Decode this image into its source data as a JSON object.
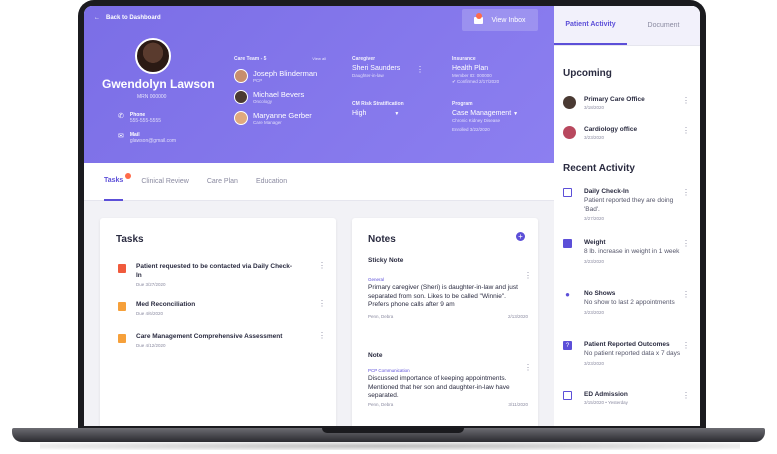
{
  "header": {
    "back_label": "Back to Dashboard",
    "inbox_label": "View Inbox",
    "patient": {
      "name": "Gwendolyn Lawson",
      "mrn": "MRN 000000",
      "phone_label": "Phone",
      "phone_value": "555-555-5555",
      "mail_label": "Mail",
      "mail_value": "glawson@gmail.com"
    },
    "care_team": {
      "title": "Care Team - 5",
      "view_all": "View all",
      "members": [
        {
          "name": "Joseph Blinderman",
          "role": "PCP"
        },
        {
          "name": "Michael Bevers",
          "role": "Oncology"
        },
        {
          "name": "Maryanne Gerber",
          "role": "Care Manager"
        }
      ]
    },
    "caregiver": {
      "label": "Caregiver",
      "name": "Sheri Saunders",
      "relation": "Daughter-in-law"
    },
    "risk": {
      "label": "CM Risk Stratification",
      "value": "High"
    },
    "insurance": {
      "label": "Insurance",
      "plan": "Health Plan",
      "member_id": "Member ID: 000000",
      "confirmed": "Confirmed 2/17/2020"
    },
    "program": {
      "label": "Program",
      "value": "Case Management",
      "detail": "Chronic Kidney Disease",
      "enrolled": "Enrolled 3/22/2020"
    }
  },
  "tabs": [
    {
      "label": "Tasks"
    },
    {
      "label": "Clinical Review"
    },
    {
      "label": "Care Plan"
    },
    {
      "label": "Education"
    }
  ],
  "tasks": {
    "title": "Tasks",
    "items": [
      {
        "title": "Patient requested to be contacted via Daily Check-In",
        "due": "Due 3/27/2020",
        "color": "#f05a3c"
      },
      {
        "title": "Med Reconciliation",
        "due": "Due 4/6/2020",
        "color": "#f6a03a"
      },
      {
        "title": "Care Management Comprehensive Assessment",
        "due": "Due 4/12/2020",
        "color": "#f6a03a"
      }
    ]
  },
  "notes": {
    "title": "Notes",
    "sticky_header": "Sticky Note",
    "sticky": {
      "category": "General",
      "body": "Primary caregiver (Sheri) is daughter-in-law and just separated from son. Likes to be called \"Winnie\". Prefers phone calls after 9 am",
      "author": "Penn, Debra",
      "date": "2/13/2020"
    },
    "note_header": "Note",
    "note": {
      "category": "PCP Communication",
      "body": "Discussed importance of keeping appointments. Mentioned that her son and daughter-in-law have separated.",
      "author": "Penn, Debra",
      "date": "3/11/2020"
    }
  },
  "panel": {
    "tabs": [
      "Patient Activity",
      "Document"
    ],
    "upcoming_title": "Upcoming",
    "upcoming": [
      {
        "title": "Primary Care Office",
        "date": "3/18/2020"
      },
      {
        "title": "Cardiology office",
        "date": "3/23/2020"
      }
    ],
    "recent_title": "Recent Activity",
    "recent": [
      {
        "title": "Daily Check-In",
        "desc": "Patient reported they are doing 'Bad'.",
        "date": "3/27/2020"
      },
      {
        "title": "Weight",
        "desc": "8 lb. increase in weight in 1 week",
        "date": "3/23/2020"
      },
      {
        "title": "No Shows",
        "desc": "No show to last 2 appointments",
        "date": "3/23/2020"
      },
      {
        "title": "Patient Reported Outcomes",
        "desc": "No patient reported data x 7 days",
        "date": "3/23/2020"
      },
      {
        "title": "ED Admission",
        "desc": "",
        "date": "3/15/2020 • Yesterday"
      }
    ]
  },
  "colors": {
    "primary": "#7b6ee6",
    "accent": "#5c4fd8",
    "alert": "#ff6b4a"
  }
}
